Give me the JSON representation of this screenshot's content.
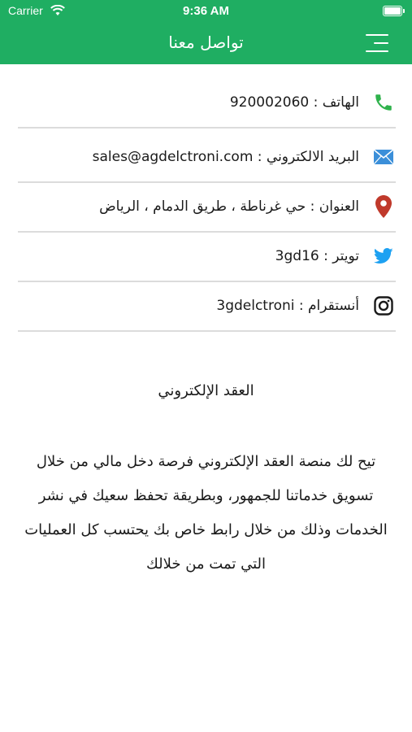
{
  "status_bar": {
    "carrier": "Carrier",
    "time": "9:36 AM"
  },
  "nav": {
    "title": "تواصل معنا"
  },
  "contacts": [
    {
      "icon": "phone-icon",
      "label": "الهاتف : 920002060"
    },
    {
      "icon": "mail-icon",
      "label": "البريد الالكتروني : sales@agdelctroni.com"
    },
    {
      "icon": "location-pin-icon",
      "label": "العنوان : حي غرناطة ، طريق الدمام ، الرياض"
    },
    {
      "icon": "twitter-icon",
      "label": "تويتر : 3gd16"
    },
    {
      "icon": "instagram-icon",
      "label": "أنستقرام : 3gdelctroni"
    }
  ],
  "section": {
    "title": "العقد الإلكتروني",
    "body": "تيح لك منصة العقد الإلكتروني فرصة دخل مالي من خلال تسويق خدماتنا للجمهور، وبطريقة تحفظ سعيك في نشر الخدمات وذلك من خلال رابط خاص بك يحتسب كل العمليات التي تمت من خلالك"
  },
  "colors": {
    "brand_green": "#1fae62",
    "phone_green": "#2fb24c",
    "pin_red": "#c0392b",
    "twitter_blue": "#1da1f2",
    "mail_blue": "#3b8fd9"
  }
}
